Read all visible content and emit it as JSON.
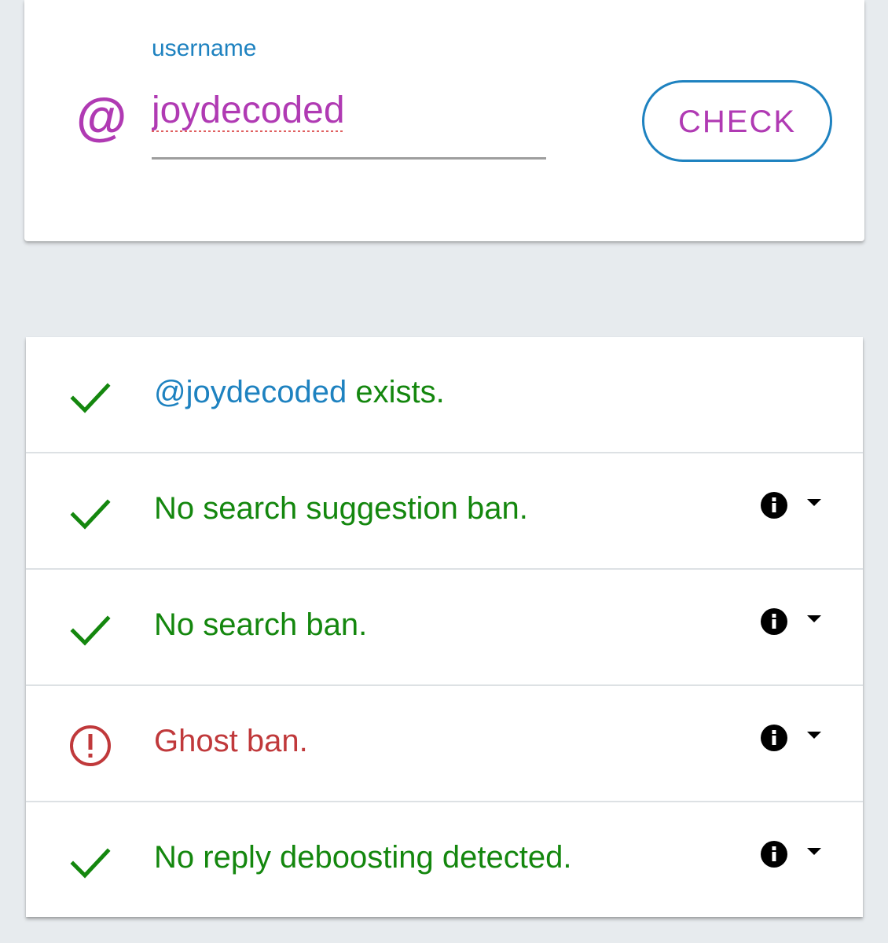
{
  "search": {
    "label": "username",
    "at_symbol": "@",
    "value": "joydecoded",
    "button_label": "CHECK"
  },
  "colors": {
    "accent_blue": "#1e82c0",
    "accent_purple": "#b03ab3",
    "ok_green": "#14870e",
    "error_red": "#c0393b"
  },
  "results": [
    {
      "status": "ok",
      "icon": "checkmark-icon",
      "handle": "@joydecoded",
      "text": " exists.",
      "expandable": false
    },
    {
      "status": "ok",
      "icon": "checkmark-icon",
      "text": "No search suggestion ban.",
      "expandable": true
    },
    {
      "status": "ok",
      "icon": "checkmark-icon",
      "text": "No search ban.",
      "expandable": true
    },
    {
      "status": "error",
      "icon": "error-circle-icon",
      "text": "Ghost ban.",
      "expandable": true
    },
    {
      "status": "ok",
      "icon": "checkmark-icon",
      "text": "No reply deboosting detected.",
      "expandable": true
    }
  ]
}
